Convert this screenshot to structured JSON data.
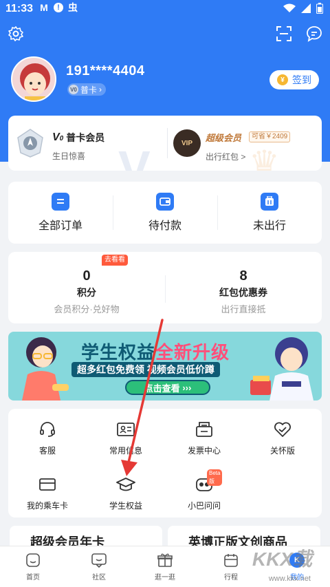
{
  "status_bar": {
    "time": "11:33",
    "notif_icons": [
      "M",
      "!",
      "虫"
    ]
  },
  "profile": {
    "phone": "191****4404",
    "level": "普卡",
    "level_mark": "V0",
    "checkin_label": "签到",
    "coin_symbol": "¥"
  },
  "member": {
    "left_title": "普卡会员",
    "left_mark": "V",
    "left_mark_sub": "0",
    "left_sub": "生日惊喜",
    "right_icon": "VIP",
    "right_title": "超级会员",
    "right_badge": "可省￥2409",
    "right_sub": "出行红包 >"
  },
  "orders": [
    {
      "label": "全部订单",
      "icon": "list-icon"
    },
    {
      "label": "待付款",
      "icon": "wallet-icon"
    },
    {
      "label": "未出行",
      "icon": "luggage-icon"
    }
  ],
  "points": [
    {
      "value": "0",
      "label": "积分",
      "sub": "会员积分·兑好物",
      "badge": "去看看"
    },
    {
      "value": "8",
      "label": "红包优惠券",
      "sub": "出行直接抵"
    }
  ],
  "banner": {
    "title_a": "学生权益",
    "title_b": "全新升级",
    "sub": "超多红包免费领  视频会员低价蹲",
    "button": "点击查看"
  },
  "services": [
    {
      "label": "客服",
      "icon": "headset-icon"
    },
    {
      "label": "常用信息",
      "icon": "id-card-icon"
    },
    {
      "label": "发票中心",
      "icon": "invoice-icon"
    },
    {
      "label": "关怀版",
      "icon": "heart-icon"
    },
    {
      "label": "我的乘车卡",
      "icon": "card-icon"
    },
    {
      "label": "学生权益",
      "icon": "graduation-cap-icon"
    },
    {
      "label": "小巴问问",
      "icon": "robot-icon",
      "badge": "Beta版"
    }
  ],
  "promos": [
    "超级会员年卡",
    "英博正版文创商品"
  ],
  "tabs": [
    {
      "label": "首页",
      "icon": "home-icon"
    },
    {
      "label": "社区",
      "icon": "community-icon"
    },
    {
      "label": "逛一逛",
      "icon": "gift-icon"
    },
    {
      "label": "行程",
      "icon": "calendar-icon"
    },
    {
      "label": "我的",
      "icon": "profile-icon",
      "mark": "K",
      "active": true
    }
  ],
  "watermark": {
    "logo": "KKX载",
    "url": "www.kkx.net"
  },
  "colors": {
    "brand": "#2f7bf5",
    "page_bg": "#f1f3f6",
    "accent_gold": "#c0793a",
    "badge_red": "#ff5a3c",
    "annotation_arrow": "#e53935"
  }
}
